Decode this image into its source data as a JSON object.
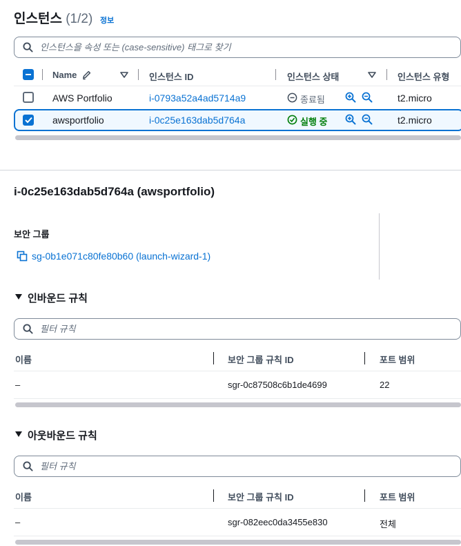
{
  "header": {
    "title": "인스턴스",
    "count": "(1/2)",
    "info_link": "정보"
  },
  "instance_search": {
    "placeholder": "인스턴스을 속성 또는 (case-sensitive) 태그로 찾기",
    "icon": "search-icon"
  },
  "instances_table": {
    "columns": {
      "name": "Name",
      "instance_id": "인스턴스 ID",
      "state": "인스턴스 상태",
      "type": "인스턴스 유형"
    },
    "rows": [
      {
        "selected": false,
        "name": "AWS Portfolio",
        "id": "i-0793a52a4ad5714a9",
        "state": "종료됨",
        "state_icon": "minus-circle-icon",
        "type": "t2.micro"
      },
      {
        "selected": true,
        "name": "awsportfolio",
        "id": "i-0c25e163dab5d764a",
        "state": "실행 중",
        "state_icon": "check-circle-icon",
        "type": "t2.micro"
      }
    ]
  },
  "detail": {
    "title": "i-0c25e163dab5d764a (awsportfolio)",
    "security_group_label": "보안 그룹",
    "security_group_link": "sg-0b1e071c80fe80b60 (launch-wizard-1)"
  },
  "inbound": {
    "title": "인바운드 규칙",
    "filter_placeholder": "필터 규칙",
    "columns": {
      "name": "이름",
      "rule_id": "보안 그룹 규칙 ID",
      "port": "포트 범위"
    },
    "rows": [
      {
        "name": "–",
        "rule_id": "sgr-0c87508c6b1de4699",
        "port": "22"
      }
    ]
  },
  "outbound": {
    "title": "아웃바운드 규칙",
    "filter_placeholder": "필터 규칙",
    "columns": {
      "name": "이름",
      "rule_id": "보안 그룹 규칙 ID",
      "port": "포트 범위"
    },
    "rows": [
      {
        "name": "–",
        "rule_id": "sgr-082eec0da3455e830",
        "port": "전체"
      }
    ]
  },
  "colors": {
    "link": "#0972d3",
    "running": "#037f0c",
    "stopped": "#5f6b7a",
    "selected_border": "#0972d3",
    "selected_bg": "#f0f8ff"
  }
}
